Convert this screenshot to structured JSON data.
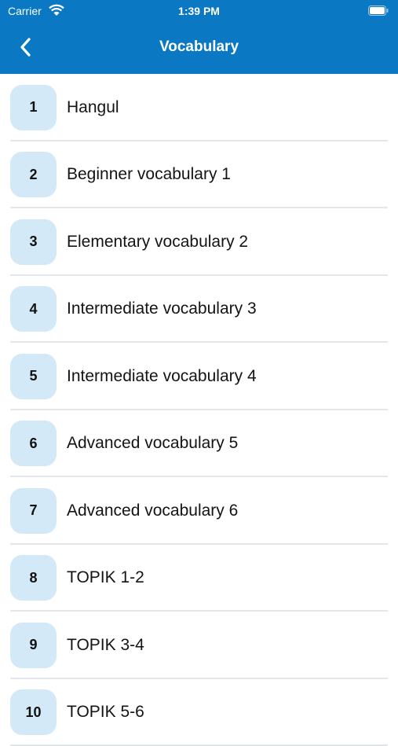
{
  "status": {
    "carrier": "Carrier",
    "time": "1:39 PM"
  },
  "nav": {
    "title": "Vocabulary",
    "back_icon": "chevron-left-icon"
  },
  "colors": {
    "brand": "#0a78c2",
    "badge": "#d3e9f7",
    "divider": "#e3e6ea"
  },
  "list": [
    {
      "number": "1",
      "title": "Hangul"
    },
    {
      "number": "2",
      "title": "Beginner vocabulary 1"
    },
    {
      "number": "3",
      "title": "Elementary vocabulary 2"
    },
    {
      "number": "4",
      "title": "Intermediate vocabulary 3"
    },
    {
      "number": "5",
      "title": "Intermediate vocabulary 4"
    },
    {
      "number": "6",
      "title": "Advanced vocabulary 5"
    },
    {
      "number": "7",
      "title": "Advanced vocabulary 6"
    },
    {
      "number": "8",
      "title": "TOPIK 1-2"
    },
    {
      "number": "9",
      "title": "TOPIK 3-4"
    },
    {
      "number": "10",
      "title": "TOPIK 5-6"
    }
  ]
}
